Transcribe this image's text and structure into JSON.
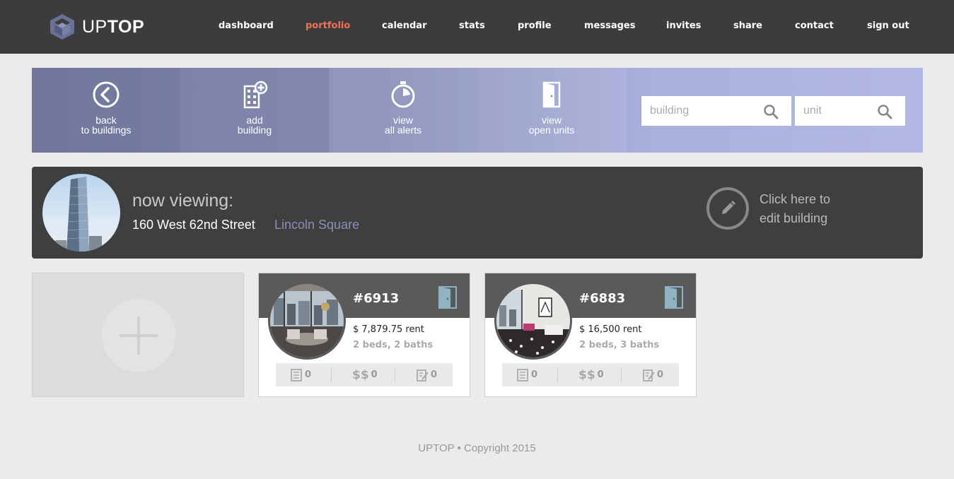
{
  "brand": {
    "name_part1": "UP",
    "name_part2": "TOP"
  },
  "nav": {
    "items": [
      {
        "label": "dashboard"
      },
      {
        "label": "portfolio",
        "active": true
      },
      {
        "label": "calendar"
      },
      {
        "label": "stats"
      },
      {
        "label": "profile"
      },
      {
        "label": "messages"
      },
      {
        "label": "invites"
      },
      {
        "label": "share"
      },
      {
        "label": "contact"
      },
      {
        "label": "sign out"
      }
    ]
  },
  "actions": [
    {
      "line1": "back",
      "line2": "to buildings",
      "icon": "back-circle-icon"
    },
    {
      "line1": "add",
      "line2": "building",
      "icon": "add-building-icon"
    },
    {
      "line1": "view",
      "line2": "all alerts",
      "icon": "stopwatch-icon"
    },
    {
      "line1": "view",
      "line2": "open units",
      "icon": "door-icon"
    }
  ],
  "search": {
    "building_placeholder": "building",
    "unit_placeholder": "unit"
  },
  "building": {
    "now_viewing": "now viewing:",
    "address": "160 West 62nd Street",
    "neighborhood": "Lincoln Square",
    "edit_line1": "Click here to",
    "edit_line2": "edit building"
  },
  "units": [
    {
      "number": "#6913",
      "rent": "$ 7,879.75 rent",
      "beds": "2 beds, 2 baths",
      "stat1": "0",
      "stat2": "0",
      "stat3": "0"
    },
    {
      "number": "#6883",
      "rent": "$ 16,500 rent",
      "beds": "2 beds, 3 baths",
      "stat1": "0",
      "stat2": "0",
      "stat3": "0"
    }
  ],
  "colors": {
    "nav_bg": "#3c3c3c",
    "active": "#f0705a",
    "accent": "#8a8fb8",
    "door": "#8fb3c0"
  },
  "footer": "UPTOP • Copyright 2015"
}
